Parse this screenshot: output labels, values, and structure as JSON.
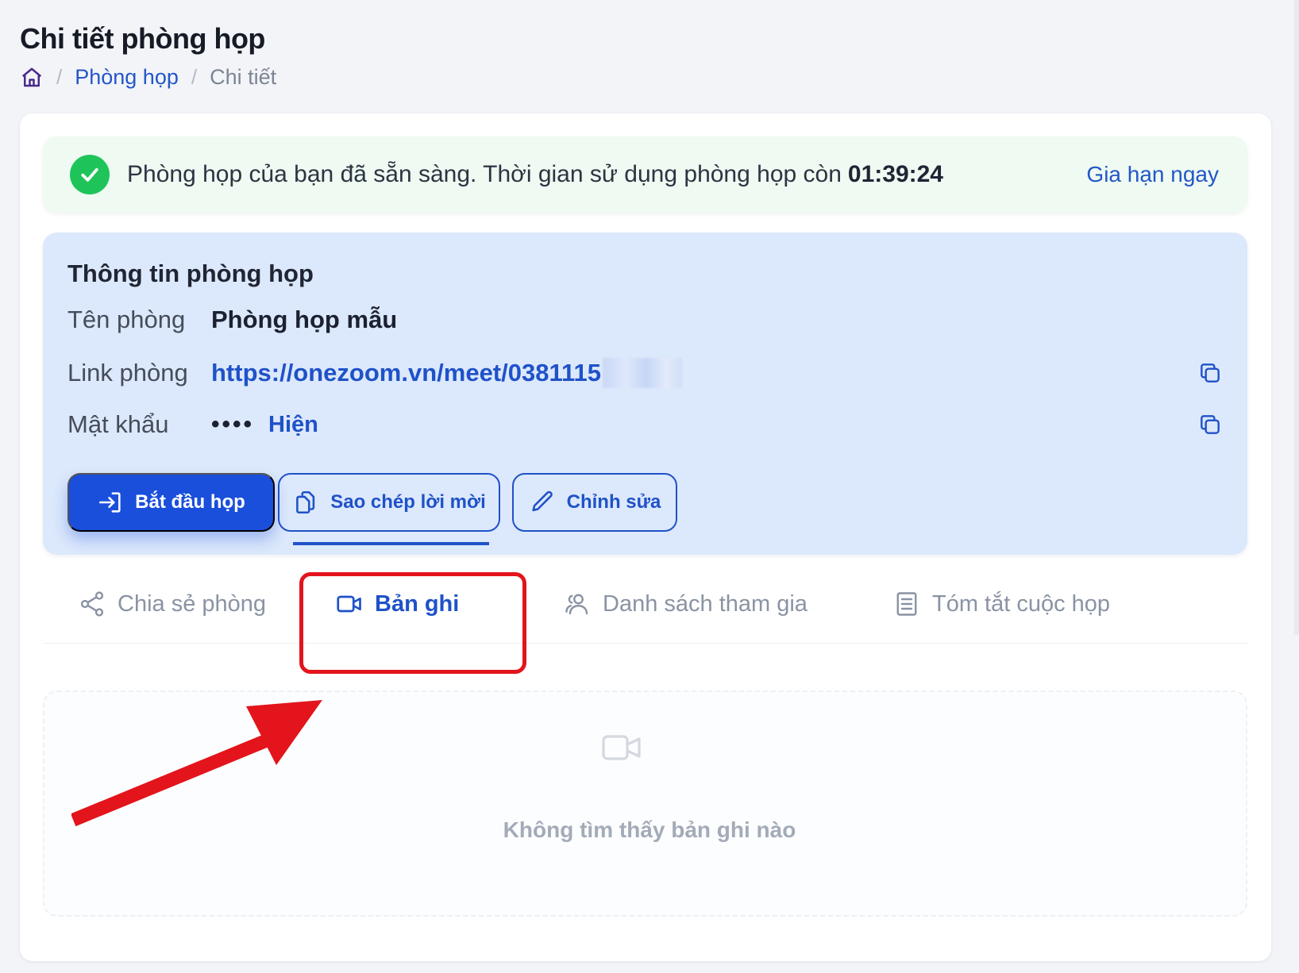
{
  "page": {
    "title": "Chi tiết phòng họp",
    "breadcrumb": {
      "home_icon": "home-icon",
      "separator": "/",
      "section": "Phòng họp",
      "current": "Chi tiết"
    }
  },
  "alert": {
    "icon": "check-circle-icon",
    "message": "Phòng họp của bạn đã sẵn sàng. Thời gian sử dụng phòng họp còn",
    "time_left": "01:39:24",
    "extend_label": "Gia hạn ngay"
  },
  "room_info": {
    "heading": "Thông tin phòng họp",
    "name_label": "Tên phòng",
    "name_value": "Phòng họp mẫu",
    "link_label": "Link phòng",
    "link_value": "https://onezoom.vn/meet/0381115",
    "password_label": "Mật khẩu",
    "password_mask": "••••",
    "show_password_label": "Hiện"
  },
  "actions": {
    "start": "Bắt đầu họp",
    "copy_invite": "Sao chép lời mời",
    "edit": "Chỉnh sửa"
  },
  "tabs": [
    {
      "label": "Chia sẻ phòng",
      "icon": "share-icon",
      "active": false
    },
    {
      "label": "Bản ghi",
      "icon": "video-icon",
      "active": true
    },
    {
      "label": "Danh sách tham gia",
      "icon": "users-icon",
      "active": false
    },
    {
      "label": "Tóm tắt cuộc họp",
      "icon": "document-icon",
      "active": false
    }
  ],
  "recordings": {
    "empty_icon": "video-icon",
    "empty_message": "Không tìm thấy bản ghi nào"
  },
  "colors": {
    "primary": "#1a4fdc",
    "link": "#1f52c8",
    "success": "#1ec45a",
    "annotation_red": "#e3141b",
    "info_bg": "#dce8fb",
    "alert_bg": "#eefaf2"
  }
}
